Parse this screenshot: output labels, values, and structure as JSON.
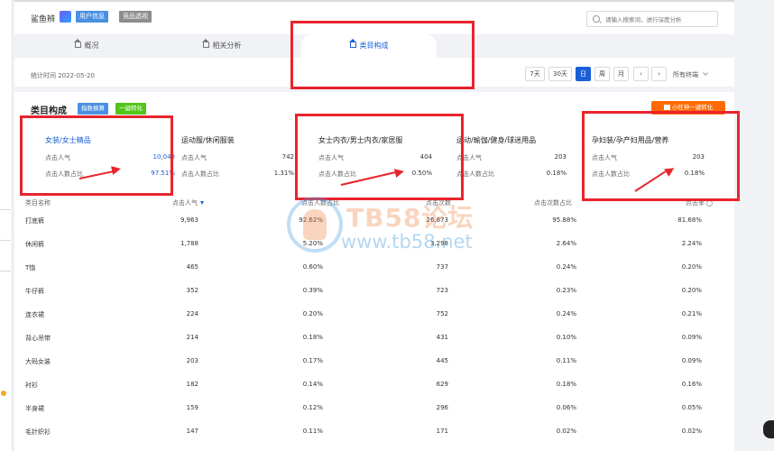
{
  "header": {
    "shop_name": "鲨鱼辨",
    "user_badge": "用户信息",
    "comp_badge": "竞品透视",
    "search_placeholder": "请输入搜索词，进行深度分析"
  },
  "tabs": [
    {
      "label": "概况"
    },
    {
      "label": "相关分析"
    },
    {
      "label": "类目构成"
    }
  ],
  "toolbar": {
    "stat_time": "统计时间 2022-05-20",
    "buttons": [
      "7天",
      "30天",
      "日",
      "周",
      "月",
      "‹",
      "›"
    ],
    "active_button": "日",
    "terminal": "所有终端"
  },
  "panel": {
    "title": "类目构成",
    "btn_index": "指数换算",
    "btn_convert": "一键转化",
    "promo": "小旺神一键转化"
  },
  "categories": [
    {
      "name": "女装/女士精品",
      "k1": "点击人气",
      "v1": "10,049",
      "k2": "点击人数占比",
      "v2": "97.51%"
    },
    {
      "name": "运动服/休闲服装",
      "k1": "点击人气",
      "v1": "742",
      "k2": "点击人数占比",
      "v2": "1.31%"
    },
    {
      "name": "女士内衣/男士内衣/家居服",
      "k1": "点击人气",
      "v1": "404",
      "k2": "点击人数占比",
      "v2": "0.50%"
    },
    {
      "name": "运动/瑜伽/健身/球迷用品",
      "k1": "点击人气",
      "v1": "203",
      "k2": "点击人数占比",
      "v2": "0.18%"
    },
    {
      "name": "孕妇装/孕产妇用品/营养",
      "k1": "点击人气",
      "v1": "203",
      "k2": "点击人数占比",
      "v2": "0.18%"
    }
  ],
  "table": {
    "headers": [
      "类目名称",
      "点击人气",
      "点击人数占比",
      "点击次数",
      "点击次数占比",
      "点击率"
    ],
    "rows": [
      [
        "打底裤",
        "9,963",
        "92.62%",
        "26,873",
        "95.88%",
        "81.68%"
      ],
      [
        "休闲裤",
        "1,788",
        "5.20%",
        "3,298",
        "2.64%",
        "2.24%"
      ],
      [
        "T恤",
        "465",
        "0.60%",
        "737",
        "0.24%",
        "0.20%"
      ],
      [
        "牛仔裤",
        "352",
        "0.39%",
        "723",
        "0.23%",
        "0.20%"
      ],
      [
        "连衣裙",
        "224",
        "0.20%",
        "752",
        "0.24%",
        "0.21%"
      ],
      [
        "背心吊带",
        "214",
        "0.18%",
        "431",
        "0.10%",
        "0.09%"
      ],
      [
        "大码女装",
        "203",
        "0.17%",
        "445",
        "0.11%",
        "0.09%"
      ],
      [
        "衬衫",
        "182",
        "0.14%",
        "629",
        "0.18%",
        "0.16%"
      ],
      [
        "半身裙",
        "159",
        "0.12%",
        "296",
        "0.06%",
        "0.05%"
      ],
      [
        "毛针织衫",
        "147",
        "0.11%",
        "171",
        "0.02%",
        "0.02%"
      ]
    ]
  },
  "watermark": {
    "line1": "TB58论坛",
    "line2": "www.tb58.net"
  },
  "colors": {
    "accent": "#1a5fd6",
    "annotation": "#e8242c",
    "promo": "#ff6a00"
  }
}
